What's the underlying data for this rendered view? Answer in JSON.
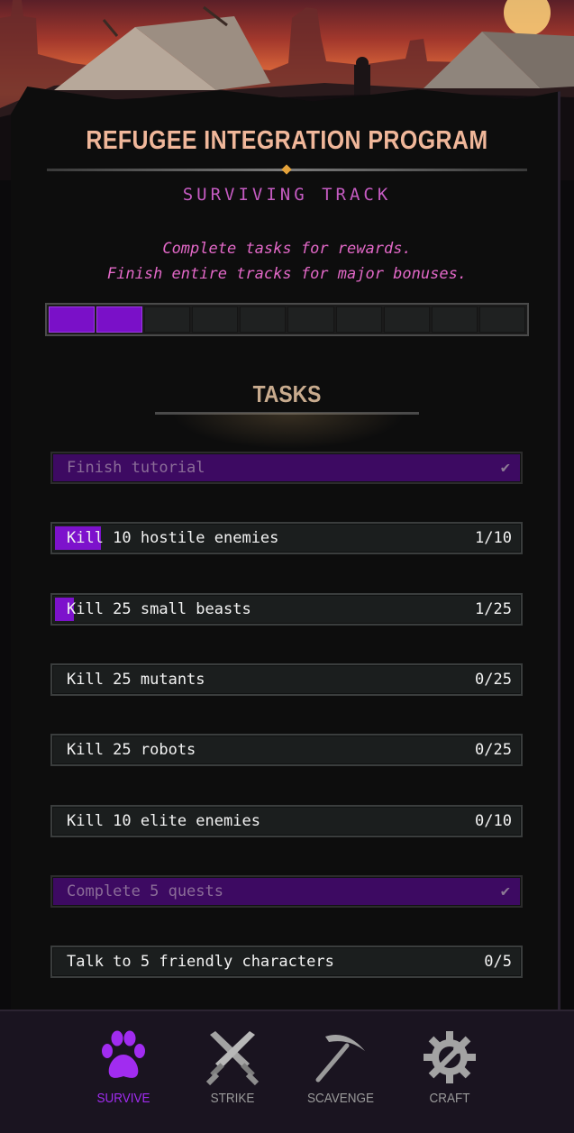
{
  "header": {
    "title": "REFUGEE INTEGRATION PROGRAM",
    "track": "SURVIVING TRACK",
    "description_line1": "Complete tasks for rewards.",
    "description_line2": "Finish entire tracks for major bonuses."
  },
  "track_progress": {
    "filled_segments": 2,
    "total_segments": 10
  },
  "tasks_heading": "TASKS",
  "tasks": [
    {
      "label": "Finish tutorial",
      "progress": "",
      "completed": true,
      "fraction": 1
    },
    {
      "label": "Kill 10 hostile enemies",
      "progress": "1/10",
      "completed": false,
      "fraction": 0.1
    },
    {
      "label": "Kill 25 small beasts",
      "progress": "1/25",
      "completed": false,
      "fraction": 0.04
    },
    {
      "label": "Kill 25 mutants",
      "progress": "0/25",
      "completed": false,
      "fraction": 0
    },
    {
      "label": "Kill 25 robots",
      "progress": "0/25",
      "completed": false,
      "fraction": 0
    },
    {
      "label": "Kill 10 elite enemies",
      "progress": "0/10",
      "completed": false,
      "fraction": 0
    },
    {
      "label": "Complete 5 quests",
      "progress": "",
      "completed": true,
      "fraction": 1
    },
    {
      "label": "Talk to 5 friendly characters",
      "progress": "0/5",
      "completed": false,
      "fraction": 0
    }
  ],
  "nav": {
    "items": [
      {
        "label": "SURVIVE",
        "icon": "paw-icon",
        "active": true
      },
      {
        "label": "STRIKE",
        "icon": "crossed-blades-icon",
        "active": false
      },
      {
        "label": "SCAVENGE",
        "icon": "pickaxe-icon",
        "active": false
      },
      {
        "label": "CRAFT",
        "icon": "gear-wrench-icon",
        "active": false
      }
    ]
  },
  "colors": {
    "accent_purple": "#7d12cc",
    "active_nav": "#a12cf0",
    "title": "#f0b79a",
    "track": "#c55bc2",
    "description": "#e268c7"
  }
}
